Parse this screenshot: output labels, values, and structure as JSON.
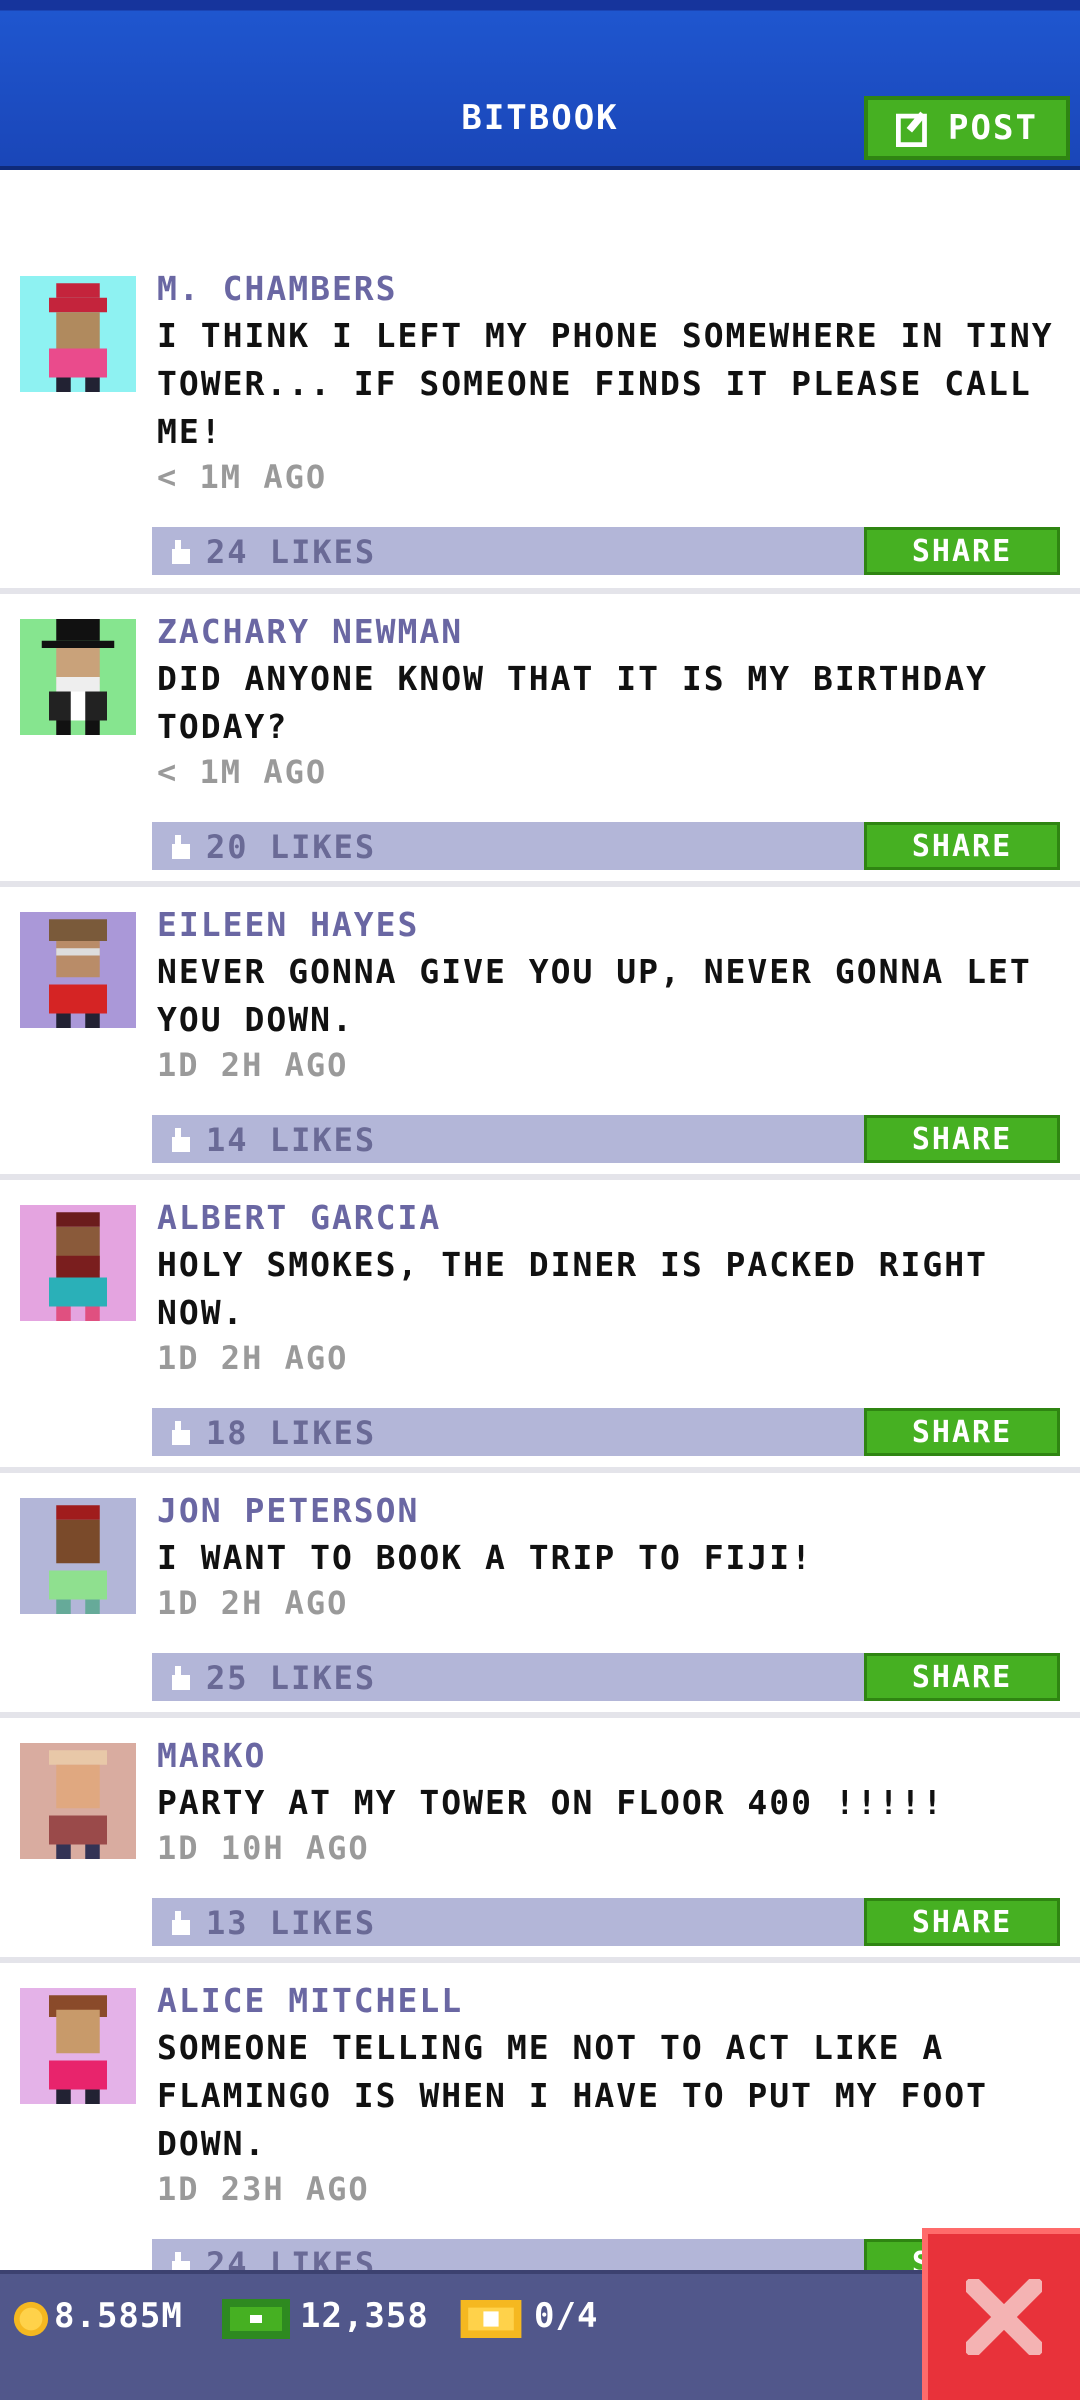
{
  "header": {
    "title": "BITBOOK",
    "post_label": "POST"
  },
  "posts": [
    {
      "author": "M. CHAMBERS",
      "message": "I THINK I LEFT MY PHONE SOMEWHERE IN TINY TOWER... IF SOMEONE FINDS IT PLEASE CALL ME!",
      "time": "< 1M AGO",
      "likes": "24 LIKES",
      "share": "SHARE",
      "avatar_bg": "#8ef2f2"
    },
    {
      "author": "ZACHARY NEWMAN",
      "message": "DID ANYONE KNOW THAT IT IS MY BIRTHDAY TODAY?",
      "time": "< 1M AGO",
      "likes": "20 LIKES",
      "share": "SHARE",
      "avatar_bg": "#86e58f"
    },
    {
      "author": "EILEEN HAYES",
      "message": "NEVER GONNA GIVE YOU UP, NEVER GONNA LET YOU DOWN.",
      "time": "1D 2H AGO",
      "likes": "14 LIKES",
      "share": "SHARE",
      "avatar_bg": "#aa98d8"
    },
    {
      "author": "ALBERT GARCIA",
      "message": "HOLY SMOKES, THE DINER IS PACKED RIGHT NOW.",
      "time": "1D 2H AGO",
      "likes": "18 LIKES",
      "share": "SHARE",
      "avatar_bg": "#e4a4e0"
    },
    {
      "author": "JON PETERSON",
      "message": "I WANT TO BOOK A TRIP TO FIJI!",
      "time": "1D 2H AGO",
      "likes": "25 LIKES",
      "share": "SHARE",
      "avatar_bg": "#b3b6d8"
    },
    {
      "author": "MARKO",
      "message": "PARTY AT MY TOWER ON FLOOR 400 !!!!!",
      "time": "1D 10H AGO",
      "likes": "13 LIKES",
      "share": "SHARE",
      "avatar_bg": "#d9aca0"
    },
    {
      "author": "ALICE MITCHELL",
      "message": "SOMEONE TELLING ME NOT TO ACT LIKE A FLAMINGO IS WHEN I HAVE TO PUT MY FOOT DOWN.",
      "time": "1D 23H AGO",
      "likes": "24 LIKES",
      "share": "SHARE",
      "avatar_bg": "#e4b2e8"
    }
  ],
  "status_bar": {
    "coins": "8.585M",
    "bux": "12,358",
    "tickets": "0/4"
  },
  "colors": {
    "accent_green": "#46b022",
    "header_blue": "#1a46b8",
    "likes_bar": "#b3b6d8",
    "close_red": "#e8323a"
  }
}
